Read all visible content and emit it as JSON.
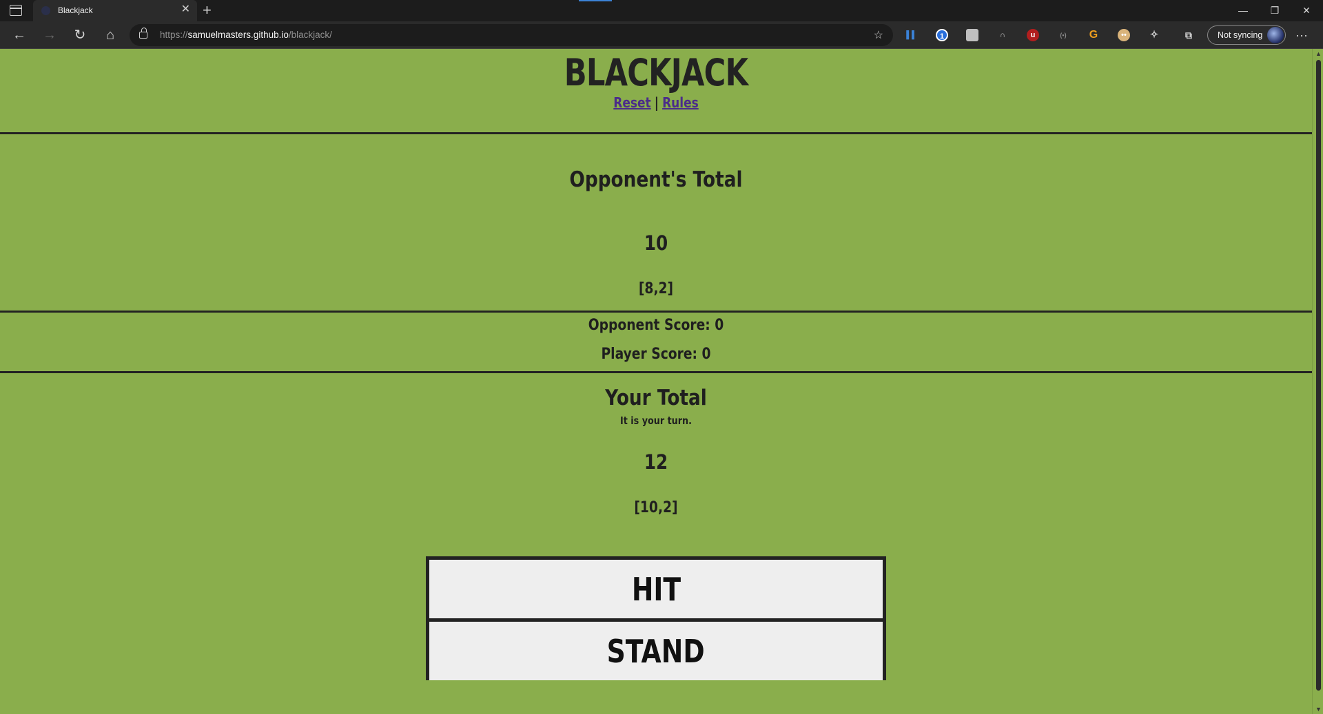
{
  "browser": {
    "tab_title": "Blackjack",
    "url_scheme": "https://",
    "url_host": "samuelmasters.github.io",
    "url_path": "/blackjack/",
    "profile_label": "Not syncing",
    "icons": [
      "tab-actions-icon",
      "new-tab-icon",
      "back-icon",
      "forward-icon",
      "refresh-icon",
      "home-icon",
      "lock-icon",
      "favorites-star-icon",
      "collections-icon",
      "more-icon"
    ]
  },
  "game": {
    "title": "BLACKJACK",
    "links": {
      "reset": "Reset",
      "separator": "|",
      "rules": "Rules"
    },
    "opponent": {
      "heading": "Opponent's Total",
      "total": "10",
      "cards": "[8,2]"
    },
    "scores": {
      "opponent": "Opponent Score: 0",
      "player": "Player Score: 0"
    },
    "player": {
      "heading": "Your Total",
      "status": "It is your turn.",
      "total": "12",
      "cards": "[10,2]"
    },
    "buttons": {
      "hit": "HIT",
      "stand": "STAND"
    }
  },
  "colors": {
    "page_background": "#8aae4c",
    "text": "#1f1f1f",
    "link": "#4b2c8a",
    "button_background": "#eeeeee",
    "border": "#222222"
  }
}
